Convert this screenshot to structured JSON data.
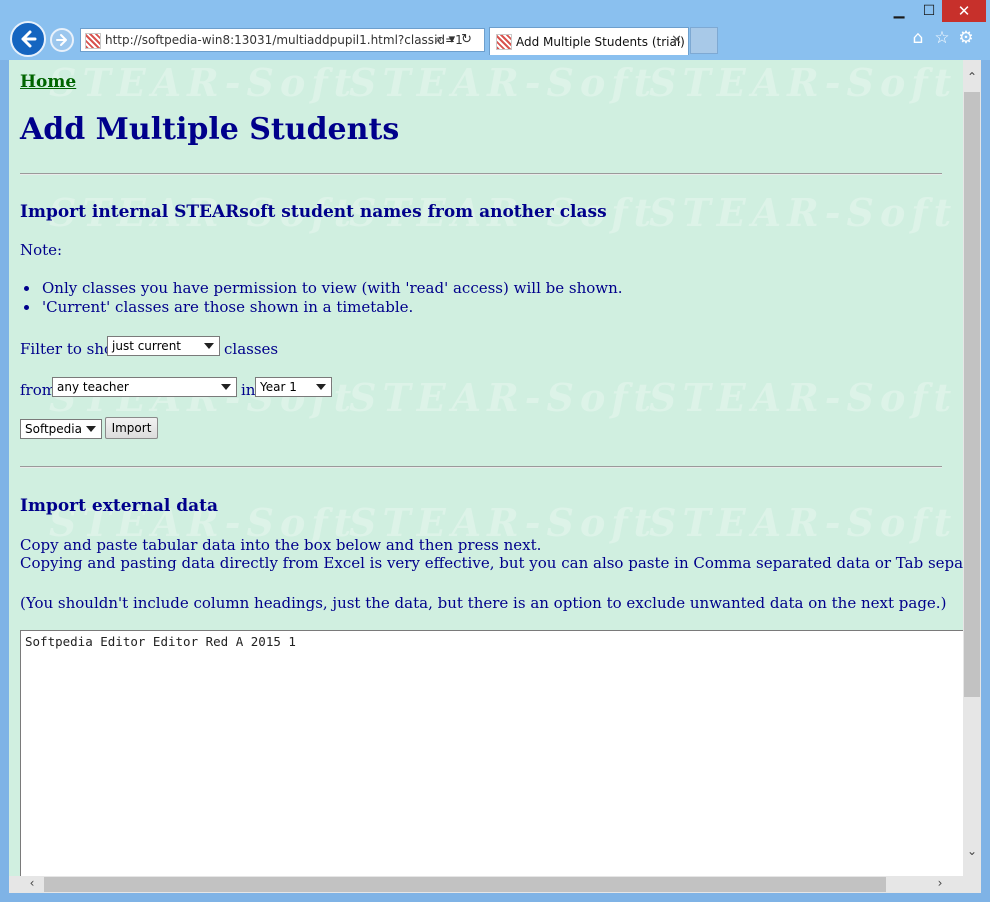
{
  "browser": {
    "address": "http://softpedia-win8:13031/multiaddpupil1.html?classid=1",
    "tab_label": "Add Multiple Students (trial)"
  },
  "page": {
    "home_link": "Home",
    "title": "Add Multiple Students",
    "internal_section": {
      "heading": "Import internal STEARsoft student names from another class",
      "note_label": "Note:",
      "notes": [
        "Only classes you have permission to view (with 'read' access) will be shown.",
        "'Current' classes are those shown in a timetable."
      ],
      "filter_prefix": "Filter to show",
      "filter_value": "just current",
      "filter_suffix": "classes",
      "from_label": "from",
      "teacher_value": "any teacher",
      "in_label": "in",
      "year_value": "Year 1",
      "class_value": "Softpedia",
      "import_button": "Import"
    },
    "external_section": {
      "heading": "Import external data",
      "line1": "Copy and paste tabular data into the box below and then press next.",
      "line2": "Copying and pasting data directly from Excel is very effective, but you can also paste in Comma separated data or Tab separated data.",
      "line3": "(You shouldn't include column headings, just the data, but there is an option to exclude unwanted data on the next page.)",
      "pasted_data": "Softpedia Editor Editor Red A 2015 1"
    },
    "watermark_text": "STEAR-Soft"
  }
}
